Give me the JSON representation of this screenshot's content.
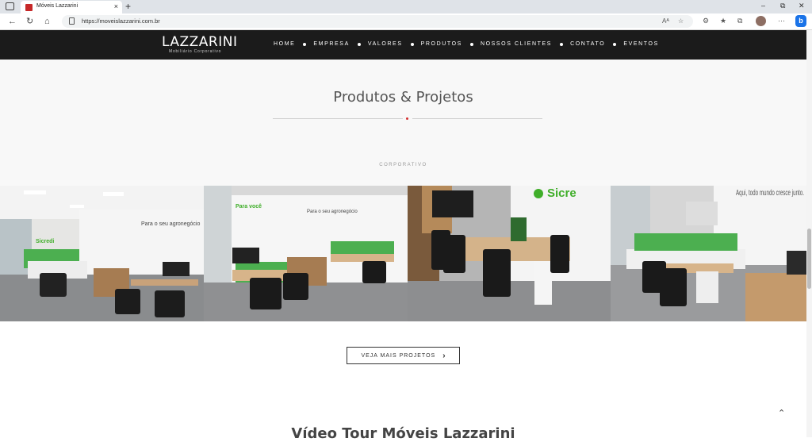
{
  "browser": {
    "tab_title": "Móveis Lazzarini",
    "tab_close": "×",
    "new_tab": "+",
    "url": "https://moveislazzarini.com.br",
    "window_controls": [
      "–",
      "⧉",
      "✕"
    ],
    "read_aloud": "Aᴬ",
    "icons": [
      "back-icon",
      "refresh-icon",
      "home-icon",
      "lock-icon",
      "read-aloud-icon",
      "favorite-icon",
      "extensions-icon",
      "favorites-list-icon",
      "collections-icon",
      "profile-avatar",
      "menu-icon",
      "bing-icon"
    ]
  },
  "header": {
    "logo": "LAZZARINI",
    "logo_subtitle": "Mobiliário Corporativo",
    "menu": [
      "HOME",
      "EMPRESA",
      "VALORES",
      "PRODUTOS",
      "NOSSOS CLIENTES",
      "CONTATO",
      "EVENTOS"
    ]
  },
  "section": {
    "title": "Produtos & Projetos",
    "category": "CORPORATIVO"
  },
  "gallery": {
    "photos": [
      {
        "wall_text": "Para o seu agronegócio",
        "brand": "Sicredi"
      },
      {
        "wall_text": "Para você",
        "wall_text2": "Para o seu agronegócio"
      },
      {
        "brand": "Sicre"
      },
      {
        "wall_text": "Aqui, todo mundo cresce junto."
      }
    ]
  },
  "more_button": {
    "label": "VEJA MAIS PROJETOS",
    "arrow": "›"
  },
  "video": {
    "title": "Vídeo Tour Móveis Lazzarini"
  },
  "to_top": "⌃",
  "colors": {
    "header_bg": "#1b1b1b",
    "accent": "#d32f2f",
    "sicredi_green": "#3fae29"
  }
}
